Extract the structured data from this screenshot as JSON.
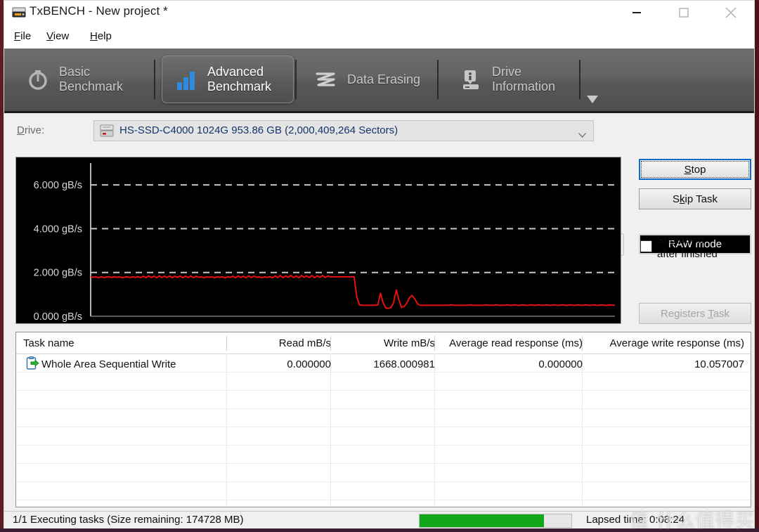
{
  "window": {
    "title": "TxBENCH - New project *",
    "icon": "drive-bench-icon",
    "minimize": "minimize-icon",
    "maximize": "maximize-icon",
    "close": "close-icon"
  },
  "menu": {
    "items": [
      {
        "label": "File",
        "accel": "F"
      },
      {
        "label": "View",
        "accel": "V"
      },
      {
        "label": "Help",
        "accel": "H"
      }
    ]
  },
  "tabs": [
    {
      "label": "Basic\nBenchmark",
      "icon": "stopwatch-icon",
      "active": false
    },
    {
      "label": "Advanced\nBenchmark",
      "icon": "bar-chart-icon",
      "active": true
    },
    {
      "label": "Data Erasing",
      "icon": "eraser-wave-icon",
      "active": false
    },
    {
      "label": "Drive\nInformation",
      "icon": "drive-info-icon",
      "active": false
    }
  ],
  "tabs_overflow_icon": "chevron-down-icon",
  "drive": {
    "label": "Drive:",
    "label_accel": "D",
    "selected": "HS-SSD-C4000 1024G  953.86 GB (2,000,409,264 Sectors)",
    "icon": "hard-drive-icon",
    "dropdown_icon": "chevron-down-icon",
    "refresh_icon": "refresh-icon",
    "raw_mode_label": "RAW mode"
  },
  "controls": {
    "stop_label": "Stop",
    "stop_accel": "S",
    "skip_label": "Skip Task",
    "skip_accel": "k",
    "shutdown_label": "Shutdown\nafter finished",
    "shutdown_accel": "u",
    "shutdown_checked": false,
    "registers_label": "Registers Task",
    "registers_accel": "T",
    "registers_disabled": true
  },
  "chart_data": {
    "type": "line",
    "title": "",
    "xlabel": "",
    "ylabel": "",
    "y_unit": "gB/s",
    "ytick_labels": [
      "6.000 gB/s",
      "4.000 gB/s",
      "2.000 gB/s",
      "0.000 gB/s"
    ],
    "ytick_values": [
      6.0,
      4.0,
      2.0,
      0.0
    ],
    "ylim": [
      0,
      7
    ],
    "grid": true,
    "grid_values": [
      2.0,
      4.0,
      6.0
    ],
    "background": "#000000",
    "axis_color": "#b4b4b4",
    "grid_color": "#c8c8c8",
    "series": [
      {
        "name": "Write speed",
        "color": "#e81010",
        "values": [
          1.8,
          1.78,
          1.8,
          1.76,
          1.8,
          1.77,
          1.79,
          1.8,
          1.77,
          1.8,
          1.78,
          1.8,
          1.76,
          1.79,
          1.8,
          1.77,
          1.8,
          1.78,
          1.8,
          1.77,
          1.83,
          1.76,
          1.84,
          1.77,
          1.83,
          1.76,
          1.84,
          1.77,
          1.83,
          1.77,
          1.84,
          1.76,
          1.83,
          1.78,
          1.84,
          1.76,
          1.83,
          1.77,
          1.84,
          1.76,
          1.83,
          1.78,
          1.8,
          1.76,
          1.8,
          1.78,
          1.8,
          1.76,
          1.8,
          1.78,
          1.8,
          1.76,
          1.8,
          1.78,
          1.83,
          1.76,
          1.84,
          1.77,
          1.83,
          1.76,
          1.84,
          1.77,
          1.83,
          1.78,
          1.8,
          1.76,
          1.8,
          1.78,
          1.8,
          1.76,
          1.84,
          1.77,
          1.86,
          1.76,
          1.84,
          1.78,
          1.86,
          1.77,
          1.84,
          1.76,
          1.86,
          1.78,
          1.84,
          1.77,
          1.86,
          1.76,
          1.84,
          1.78,
          1.86,
          1.77,
          1.84,
          1.8,
          1.8,
          1.8,
          1.8,
          1.8,
          1.8,
          1.8,
          1.8,
          1.8,
          1.8,
          0.9,
          0.52,
          0.5,
          0.5,
          0.5,
          0.5,
          0.5,
          0.5,
          0.52,
          1.05,
          0.62,
          0.38,
          0.36,
          0.4,
          0.62,
          1.2,
          0.75,
          0.4,
          0.45,
          0.6,
          0.85,
          0.95,
          0.8,
          0.58,
          0.5,
          0.5,
          0.5,
          0.5,
          0.5,
          0.5,
          0.5,
          0.5,
          0.5,
          0.5,
          0.5,
          0.5,
          0.52,
          0.5,
          0.5,
          0.5,
          0.5,
          0.5,
          0.5,
          0.52,
          0.5,
          0.5,
          0.5,
          0.5,
          0.5,
          0.52,
          0.5,
          0.5,
          0.5,
          0.52,
          0.5,
          0.5,
          0.5,
          0.52,
          0.5,
          0.5,
          0.52,
          0.5,
          0.5,
          0.52,
          0.5,
          0.5,
          0.52,
          0.5,
          0.5,
          0.52,
          0.5,
          0.5,
          0.52,
          0.5,
          0.5,
          0.52,
          0.5,
          0.5,
          0.52,
          0.5,
          0.5,
          0.52,
          0.5,
          0.5,
          0.52,
          0.5,
          0.5,
          0.52,
          0.5,
          0.5,
          0.52,
          0.5,
          0.5,
          0.52,
          0.5,
          0.5,
          0.52,
          0.5,
          0.5
        ]
      }
    ]
  },
  "table": {
    "columns": [
      {
        "label": "Task name",
        "align": "left"
      },
      {
        "label": "Read mB/s",
        "align": "right"
      },
      {
        "label": "Write mB/s",
        "align": "right"
      },
      {
        "label": "Average read response (ms)",
        "align": "right"
      },
      {
        "label": "Average write response (ms)",
        "align": "right"
      }
    ],
    "rows": [
      {
        "icon": "task-write-icon",
        "task_name": "Whole Area Sequential Write",
        "read": "0.000000",
        "write": "1668.000981",
        "avg_read_response": "0.000000",
        "avg_write_response": "10.057007"
      }
    ]
  },
  "status": {
    "text": "1/1 Executing tasks (Size remaining: 174728 MB)",
    "progress_percent": 82,
    "progress_color": "#10a81a",
    "lapsed": "Lapsed time: 0:08:24",
    "watermark": "值 什么值得买"
  }
}
